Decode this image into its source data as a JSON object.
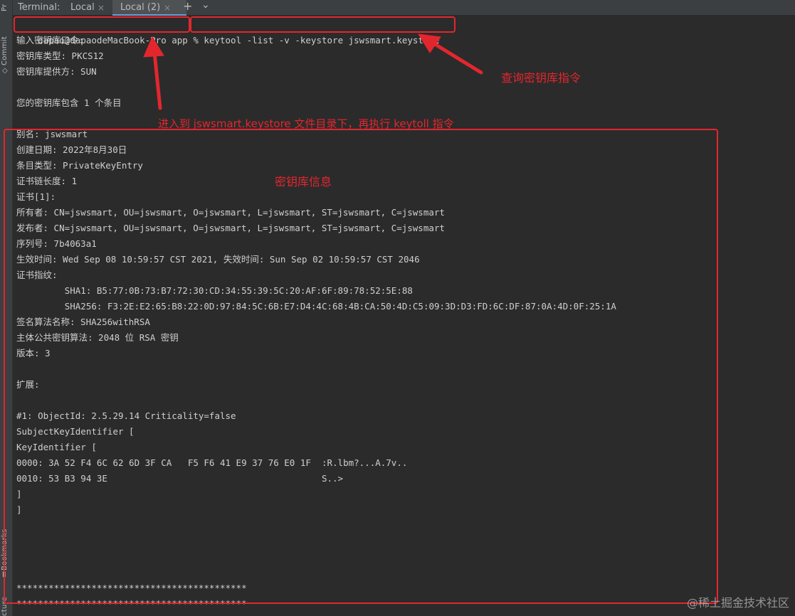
{
  "sidebar": {
    "top_label": "Pr",
    "commit_label": "Commit",
    "bookmarks_label": "Bookmarks",
    "structure_label": "cture"
  },
  "tabbar": {
    "title": "Terminal:",
    "tabs": [
      {
        "label": "Local",
        "close": "×"
      },
      {
        "label": "Local (2)",
        "close": "×"
      }
    ],
    "add": "+",
    "chevron": "⌄"
  },
  "terminal": {
    "prompt": "dapao@dapaodeMacBook-Pro app %",
    "command": "keytool -list -v -keystore jswsmart.keystore",
    "output_top": [
      "输入密钥库口令:",
      "密钥库类型: PKCS12",
      "密钥库提供方: SUN",
      "",
      "您的密钥库包含 1 个条目"
    ],
    "output_info": [
      "别名: jswsmart",
      "创建日期: 2022年8月30日",
      "条目类型: PrivateKeyEntry",
      "证书链长度: 1",
      "证书[1]:",
      "所有者: CN=jswsmart, OU=jswsmart, O=jswsmart, L=jswsmart, ST=jswsmart, C=jswsmart",
      "发布者: CN=jswsmart, OU=jswsmart, O=jswsmart, L=jswsmart, ST=jswsmart, C=jswsmart",
      "序列号: 7b4063a1",
      "生效时间: Wed Sep 08 10:59:57 CST 2021, 失效时间: Sun Sep 02 10:59:57 CST 2046",
      "证书指纹:",
      "         SHA1: B5:77:0B:73:B7:72:30:CD:34:55:39:5C:20:AF:6F:89:78:52:5E:88",
      "         SHA256: F3:2E:E2:65:B8:22:0D:97:84:5C:6B:E7:D4:4C:68:4B:CA:50:4D:C5:09:3D:D3:FD:6C:DF:87:0A:4D:0F:25:1A",
      "签名算法名称: SHA256withRSA",
      "主体公共密钥算法: 2048 位 RSA 密钥",
      "版本: 3",
      "",
      "扩展:",
      "",
      "#1: ObjectId: 2.5.29.14 Criticality=false",
      "SubjectKeyIdentifier [",
      "KeyIdentifier [",
      "0000: 3A 52 F4 6C 62 6D 3F CA   F5 F6 41 E9 37 76 E0 1F  :R.lbm?...A.7v..",
      "0010: 53 B3 94 3E                                        S..>",
      "]",
      "]",
      "",
      "",
      "",
      "",
      "*******************************************",
      "*******************************************"
    ]
  },
  "annotations": {
    "query_command": "查询密钥库指令",
    "enter_dir": "进入到 jswsmart.keystore 文件目录下，再执行 keytoll 指令",
    "keystore_info": "密钥库信息",
    "color": "#e3262e"
  },
  "watermark": "@稀土掘金技术社区"
}
